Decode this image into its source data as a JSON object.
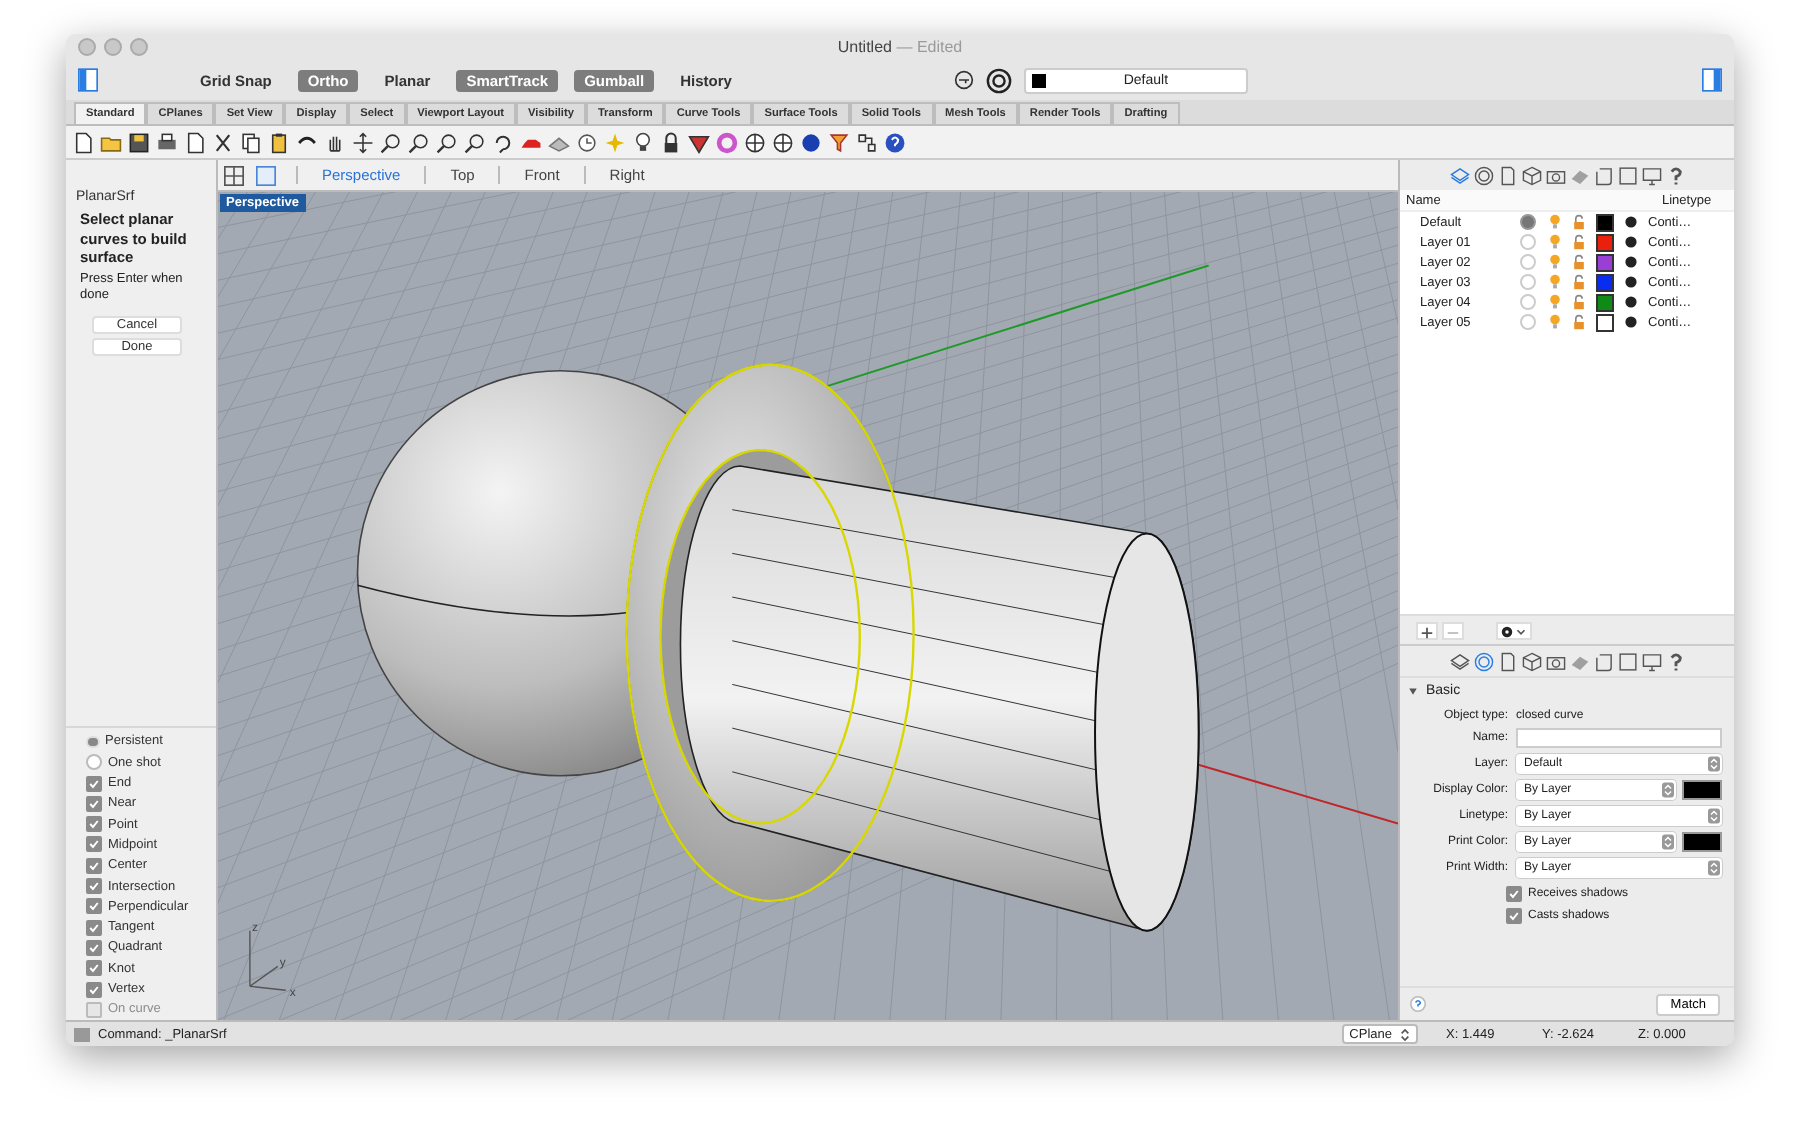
{
  "window": {
    "title": "Untitled",
    "subtitle": "— Edited"
  },
  "modes": [
    {
      "label": "Grid Snap",
      "on": false
    },
    {
      "label": "Ortho",
      "on": true
    },
    {
      "label": "Planar",
      "on": false
    },
    {
      "label": "SmartTrack",
      "on": true
    },
    {
      "label": "Gumball",
      "on": true
    },
    {
      "label": "History",
      "on": false
    }
  ],
  "layer_selector": {
    "value": "Default",
    "color": "#000000"
  },
  "toolbar_tabs": [
    {
      "label": "Standard",
      "selected": true
    },
    {
      "label": "CPlanes",
      "selected": false
    },
    {
      "label": "Set View",
      "selected": false
    },
    {
      "label": "Display",
      "selected": false
    },
    {
      "label": "Select",
      "selected": false
    },
    {
      "label": "Viewport Layout",
      "selected": false
    },
    {
      "label": "Visibility",
      "selected": false
    },
    {
      "label": "Transform",
      "selected": false
    },
    {
      "label": "Curve Tools",
      "selected": false
    },
    {
      "label": "Surface Tools",
      "selected": false
    },
    {
      "label": "Solid Tools",
      "selected": false
    },
    {
      "label": "Mesh Tools",
      "selected": false
    },
    {
      "label": "Render Tools",
      "selected": false
    },
    {
      "label": "Drafting",
      "selected": false
    }
  ],
  "viewport_tabs": [
    {
      "label": "Perspective",
      "selected": true
    },
    {
      "label": "Top",
      "selected": false
    },
    {
      "label": "Front",
      "selected": false
    },
    {
      "label": "Right",
      "selected": false
    }
  ],
  "viewport": {
    "label": "Perspective",
    "axis_labels": [
      "z",
      "y",
      "x"
    ]
  },
  "command_panel": {
    "command": "PlanarSrf",
    "prompt": "Select planar curves to build surface",
    "hint": "Press Enter when done",
    "buttons": [
      "Cancel",
      "Done"
    ]
  },
  "osnap": {
    "modes": [
      {
        "label": "Persistent",
        "selected": true
      },
      {
        "label": "One shot",
        "selected": false
      }
    ],
    "snaps": [
      {
        "label": "End",
        "checked": true,
        "disabled": false
      },
      {
        "label": "Near",
        "checked": true,
        "disabled": false
      },
      {
        "label": "Point",
        "checked": true,
        "disabled": false
      },
      {
        "label": "Midpoint",
        "checked": true,
        "disabled": false
      },
      {
        "label": "Center",
        "checked": true,
        "disabled": false
      },
      {
        "label": "Intersection",
        "checked": true,
        "disabled": false
      },
      {
        "label": "Perpendicular",
        "checked": true,
        "disabled": false
      },
      {
        "label": "Tangent",
        "checked": true,
        "disabled": false
      },
      {
        "label": "Quadrant",
        "checked": true,
        "disabled": false
      },
      {
        "label": "Knot",
        "checked": true,
        "disabled": false
      },
      {
        "label": "Vertex",
        "checked": true,
        "disabled": false
      },
      {
        "label": "On curve",
        "checked": false,
        "disabled": true
      }
    ]
  },
  "layer_panel_tabs": [
    {
      "selected": true
    },
    {
      "selected": false
    },
    {
      "selected": false
    },
    {
      "selected": false
    },
    {
      "selected": false
    },
    {
      "selected": false
    },
    {
      "selected": false
    },
    {
      "selected": false
    },
    {
      "selected": false
    },
    {
      "selected": false
    }
  ],
  "layers": {
    "columns": [
      "Name",
      "Linetype"
    ],
    "rows": [
      {
        "name": "Default",
        "current": true,
        "color": "#000000",
        "linetype": "Conti…"
      },
      {
        "name": "Layer 01",
        "current": false,
        "color": "#e8200c",
        "linetype": "Conti…"
      },
      {
        "name": "Layer 02",
        "current": false,
        "color": "#9a3fd6",
        "linetype": "Conti…"
      },
      {
        "name": "Layer 03",
        "current": false,
        "color": "#0a2cf0",
        "linetype": "Conti…"
      },
      {
        "name": "Layer 04",
        "current": false,
        "color": "#0f8a16",
        "linetype": "Conti…"
      },
      {
        "name": "Layer 05",
        "current": false,
        "color": "#ffffff",
        "linetype": "Conti…"
      }
    ]
  },
  "properties_panel_tabs": [
    {
      "selected": false
    },
    {
      "selected": true
    },
    {
      "selected": false
    },
    {
      "selected": false
    },
    {
      "selected": false
    },
    {
      "selected": false
    },
    {
      "selected": false
    },
    {
      "selected": false
    },
    {
      "selected": false
    },
    {
      "selected": false
    }
  ],
  "properties": {
    "section": "Basic",
    "object_type_label": "Object type:",
    "object_type": "closed curve",
    "fields": [
      {
        "kind": "text",
        "label": "Name:"
      },
      {
        "kind": "select",
        "label": "Layer:",
        "value": "Default"
      },
      {
        "kind": "select_color",
        "label": "Display Color:",
        "value": "By Layer",
        "color": "#000000"
      },
      {
        "kind": "select",
        "label": "Linetype:",
        "value": "By Layer"
      },
      {
        "kind": "select_color",
        "label": "Print Color:",
        "value": "By Layer",
        "color": "#000000"
      },
      {
        "kind": "select",
        "label": "Print Width:",
        "value": "By Layer"
      }
    ],
    "checks": [
      {
        "label": "Receives shadows",
        "checked": true
      },
      {
        "label": "Casts shadows",
        "checked": true
      }
    ],
    "button": "Match"
  },
  "status_bar": {
    "command": "Command: _PlanarSrf",
    "cplane": "CPlane",
    "x": "X: 1.449",
    "y": "Y: -2.624",
    "z": "Z: 0.000"
  }
}
